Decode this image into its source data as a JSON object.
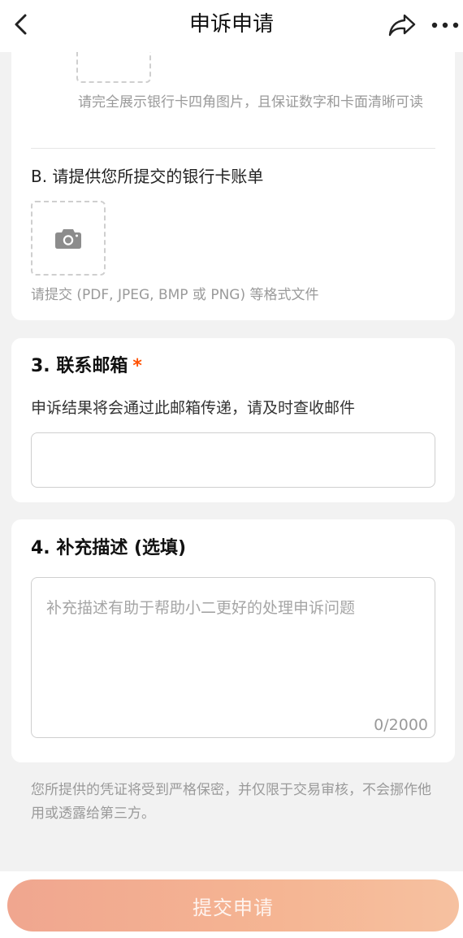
{
  "nav": {
    "title": "申诉申请"
  },
  "upload_section": {
    "item_a_hint": "请完全展示银行卡四角图片，且保证数字和卡面清晰可读",
    "item_b_label": "B. 请提供您所提交的银行卡账单",
    "item_b_hint": "请提交 (PDF, JPEG, BMP 或 PNG) 等格式文件"
  },
  "email_section": {
    "title": "3. 联系邮箱",
    "required_mark": "*",
    "description": "申诉结果将会通过此邮箱传递，请及时查收邮件",
    "value": ""
  },
  "description_section": {
    "title": "4. 补充描述 (选填)",
    "placeholder": "补充描述有助于帮助小二更好的处理申诉问题",
    "char_count": "0/2000"
  },
  "privacy_note": "您所提供的凭证将受到严格保密，并仅限于交易审核，不会挪作他用或透露给第三方。",
  "submit_label": "提交申请",
  "colors": {
    "accent": "#ff5000",
    "submit_gradient_start": "#f0a68f",
    "submit_gradient_end": "#f6c1a0"
  }
}
